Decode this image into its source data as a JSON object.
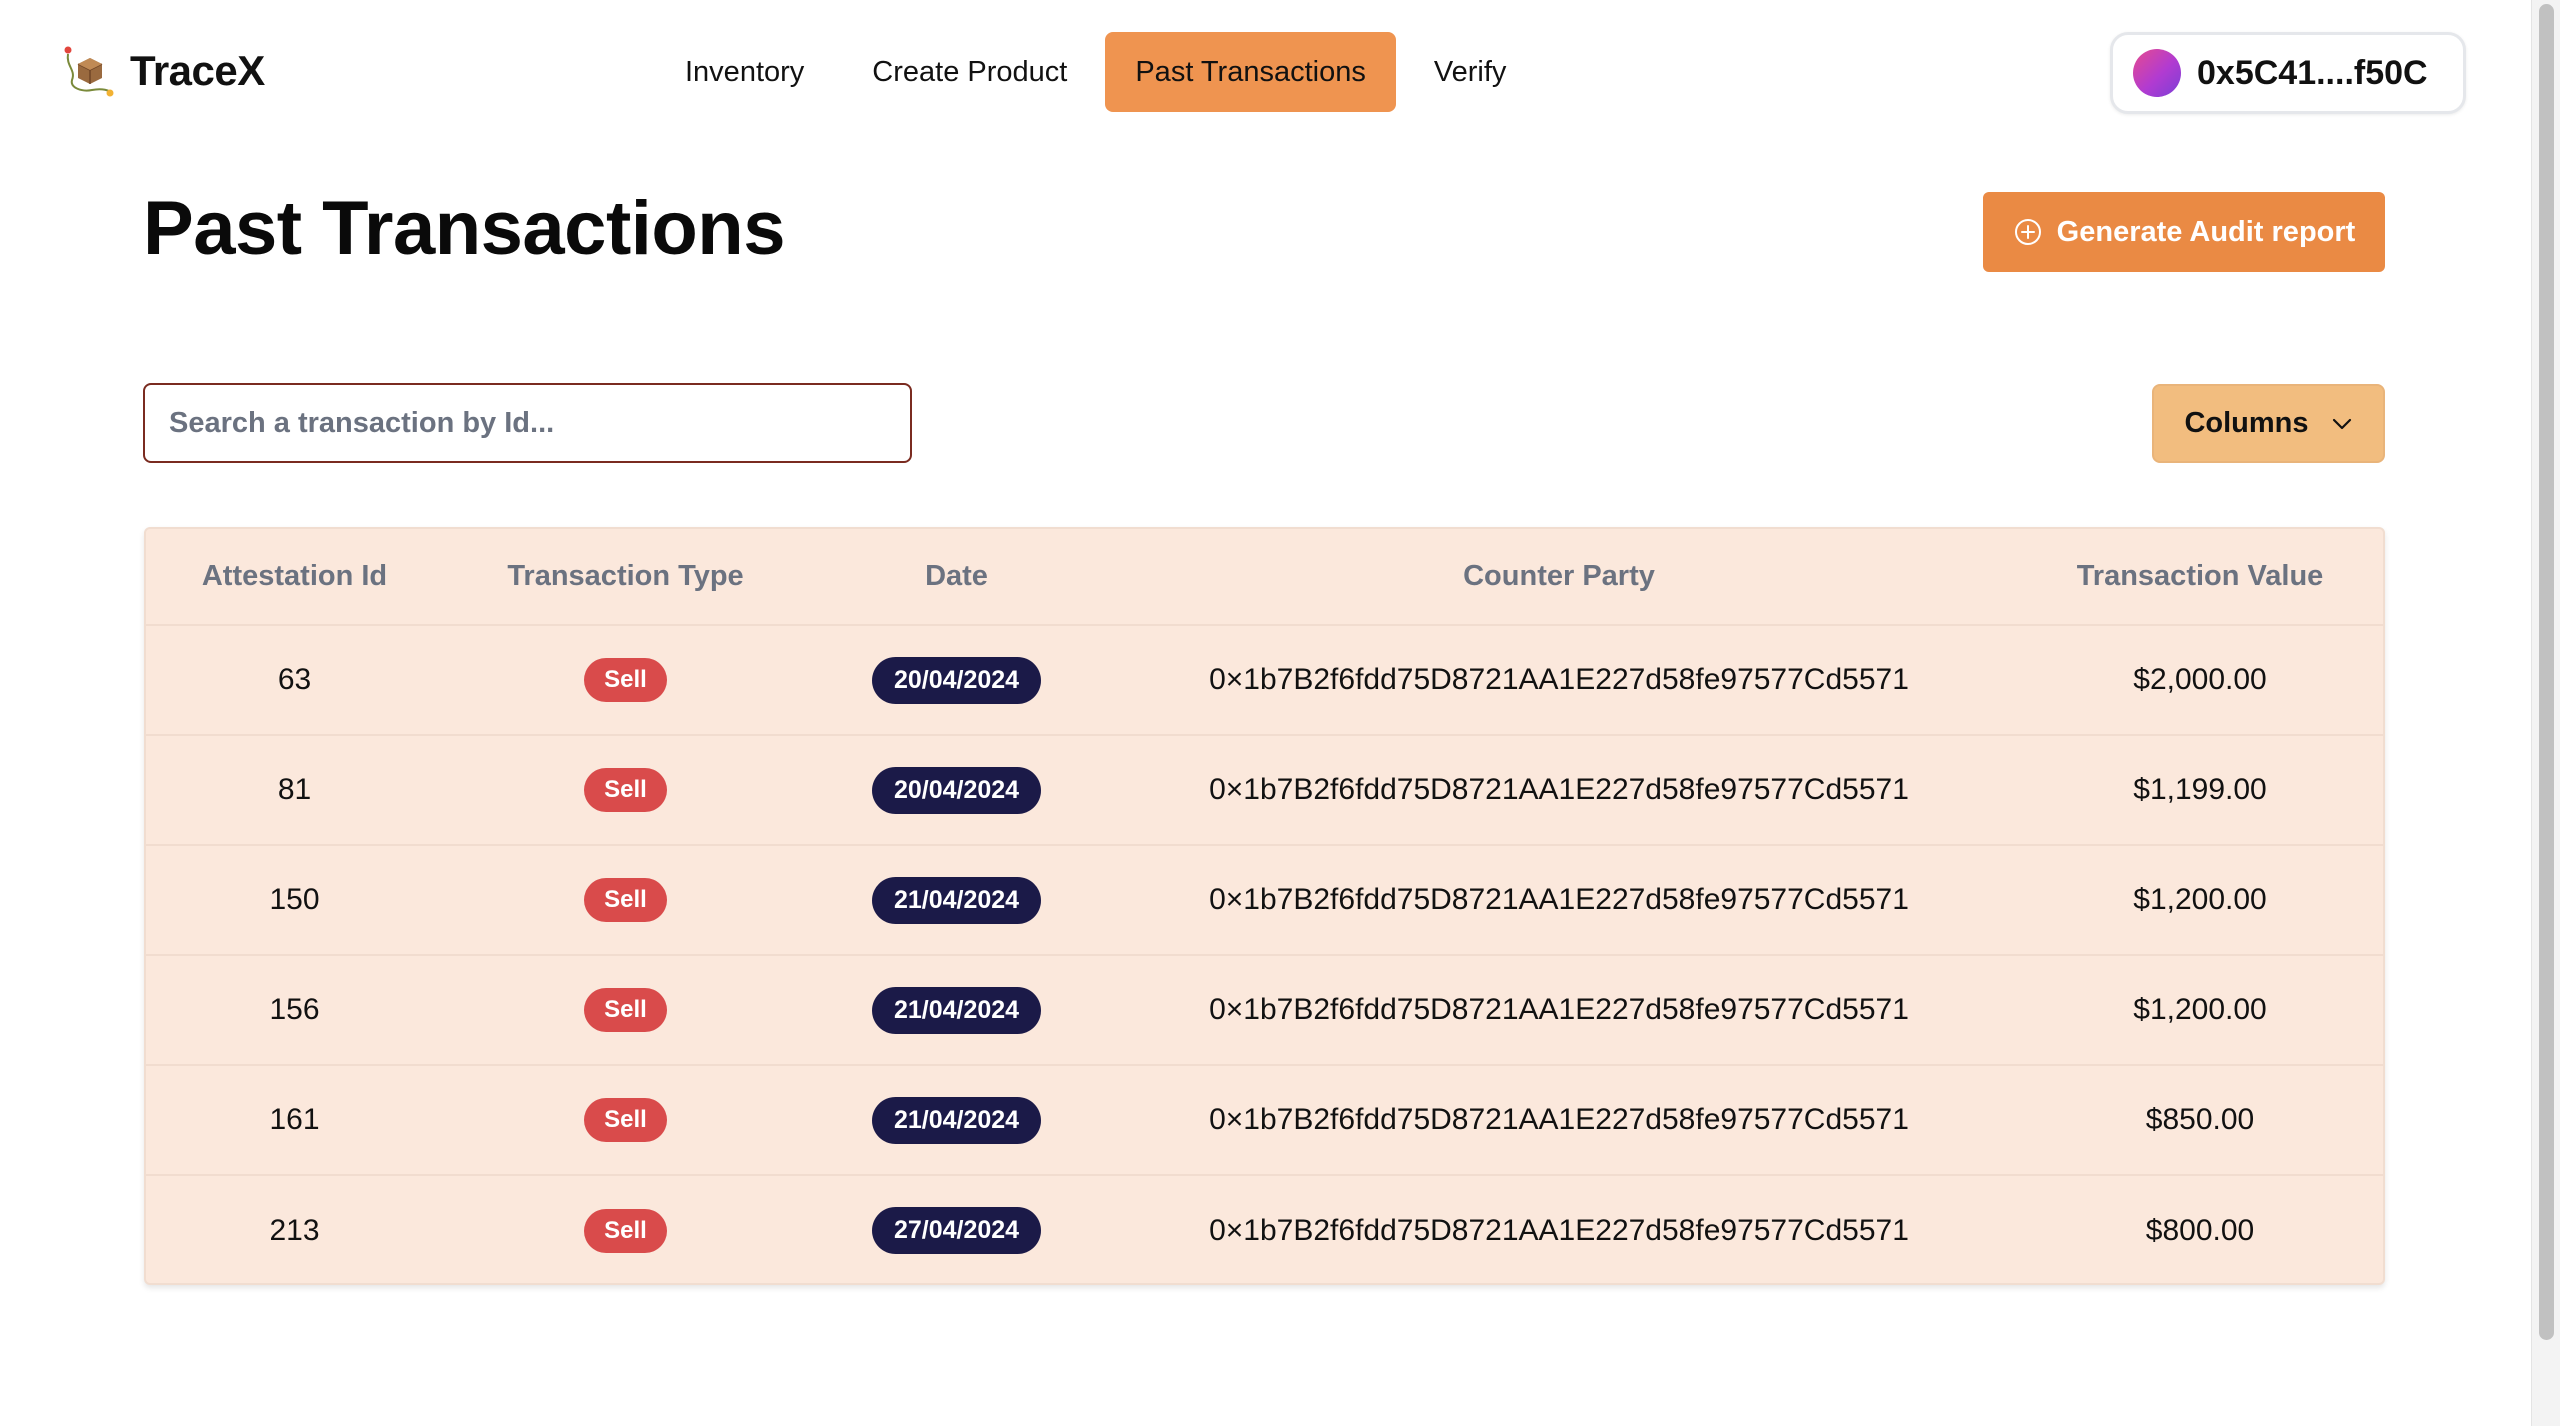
{
  "brand": {
    "name": "TraceX",
    "logo_icon": "box-route-icon"
  },
  "nav": {
    "items": [
      {
        "label": "Inventory",
        "active": false
      },
      {
        "label": "Create Product",
        "active": false
      },
      {
        "label": "Past Transactions",
        "active": true
      },
      {
        "label": "Verify",
        "active": false
      }
    ],
    "accent_color": "#ef9450"
  },
  "wallet": {
    "address": "0x5C41....f50C",
    "avatar_icon": "gradient-avatar"
  },
  "page": {
    "title": "Past Transactions",
    "audit_button_label": "Generate Audit report",
    "audit_button_icon": "plus-circle-icon"
  },
  "toolbar": {
    "search_placeholder": "Search a transaction by Id...",
    "search_value": "",
    "columns_label": "Columns",
    "columns_icon": "chevron-down-icon"
  },
  "table": {
    "headers": [
      "Attestation Id",
      "Transaction Type",
      "Date",
      "Counter Party",
      "Transaction Value"
    ],
    "rows": [
      {
        "id": "63",
        "type": "Sell",
        "date": "20/04/2024",
        "counterparty": "0×1b7B2f6fdd75D8721AA1E227d58fe97577Cd5571",
        "value": "$2,000.00"
      },
      {
        "id": "81",
        "type": "Sell",
        "date": "20/04/2024",
        "counterparty": "0×1b7B2f6fdd75D8721AA1E227d58fe97577Cd5571",
        "value": "$1,199.00"
      },
      {
        "id": "150",
        "type": "Sell",
        "date": "21/04/2024",
        "counterparty": "0×1b7B2f6fdd75D8721AA1E227d58fe97577Cd5571",
        "value": "$1,200.00"
      },
      {
        "id": "156",
        "type": "Sell",
        "date": "21/04/2024",
        "counterparty": "0×1b7B2f6fdd75D8721AA1E227d58fe97577Cd5571",
        "value": "$1,200.00"
      },
      {
        "id": "161",
        "type": "Sell",
        "date": "21/04/2024",
        "counterparty": "0×1b7B2f6fdd75D8721AA1E227d58fe97577Cd5571",
        "value": "$850.00"
      },
      {
        "id": "213",
        "type": "Sell",
        "date": "27/04/2024",
        "counterparty": "0×1b7B2f6fdd75D8721AA1E227d58fe97577Cd5571",
        "value": "$800.00"
      }
    ]
  },
  "colors": {
    "primary_button": "#ea8a44",
    "columns_button": "#f2bd7f",
    "table_background": "#fbe8dc",
    "sell_badge": "#d94b4b",
    "date_badge": "#1b1a48"
  }
}
